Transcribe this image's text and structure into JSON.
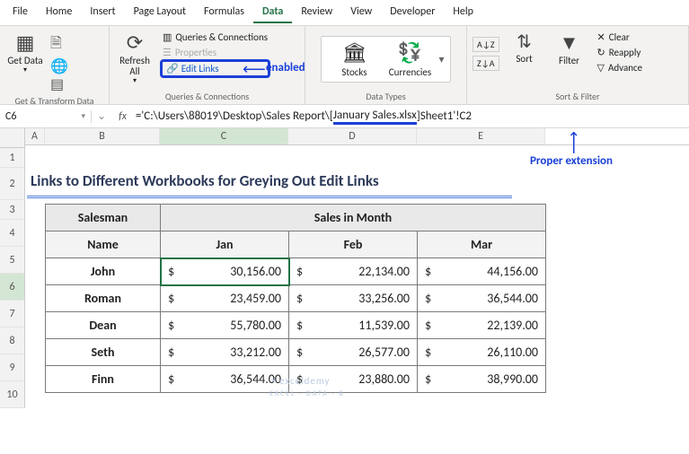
{
  "menu": {
    "file": "File",
    "home": "Home",
    "insert": "Insert",
    "page": "Page Layout",
    "formulas": "Formulas",
    "data": "Data",
    "review": "Review",
    "view": "View",
    "developer": "Developer",
    "help": "Help"
  },
  "ribbon": {
    "group_get": "Get & Transform Data",
    "get_data": "Get Data",
    "group_qc": "Queries & Connections",
    "refresh": "Refresh All",
    "qc": "Queries & Connections",
    "props": "Properties",
    "edit_links": "Edit Links",
    "group_dt": "Data Types",
    "stocks": "Stocks",
    "currencies": "Currencies",
    "group_sf": "Sort & Filter",
    "sort": "Sort",
    "filter": "Filter",
    "clear": "Clear",
    "reapply": "Reapply",
    "advanced": "Advance"
  },
  "namebox": "C6",
  "formula": {
    "pre": "='C:\\Users\\88019\\Desktop\\Sales Report\\[",
    "mid": "January Sales.xlsx",
    "post": "]Sheet1'!C2"
  },
  "annotations": {
    "enabled": "enabled",
    "proper": "Proper extension"
  },
  "cols": {
    "A": "A",
    "B": "B",
    "C": "C",
    "D": "D",
    "E": "E"
  },
  "rows": [
    "1",
    "2",
    "3",
    "4",
    "5",
    "6",
    "7",
    "8",
    "9",
    "10"
  ],
  "title": "Links to Different Workbooks for Greying Out Edit Links",
  "table": {
    "h1_left": "Salesman",
    "h1_right": "Sales in Month",
    "h2": [
      "Name",
      "Jan",
      "Feb",
      "Mar"
    ],
    "data": [
      {
        "name": "John",
        "jan": "30,156.00",
        "feb": "22,134.00",
        "mar": "44,156.00"
      },
      {
        "name": "Roman",
        "jan": "23,459.00",
        "feb": "33,256.00",
        "mar": "36,544.00"
      },
      {
        "name": "Dean",
        "jan": "55,780.00",
        "feb": "11,539.00",
        "mar": "22,139.00"
      },
      {
        "name": "Seth",
        "jan": "33,212.00",
        "feb": "26,577.00",
        "mar": "26,110.00"
      },
      {
        "name": "Finn",
        "jan": "36,544.00",
        "feb": "23,880.00",
        "mar": "38,990.00"
      }
    ]
  },
  "currency": "$",
  "watermark": {
    "main": "exceldemy",
    "sub": "EXCEL · DATA · B"
  }
}
